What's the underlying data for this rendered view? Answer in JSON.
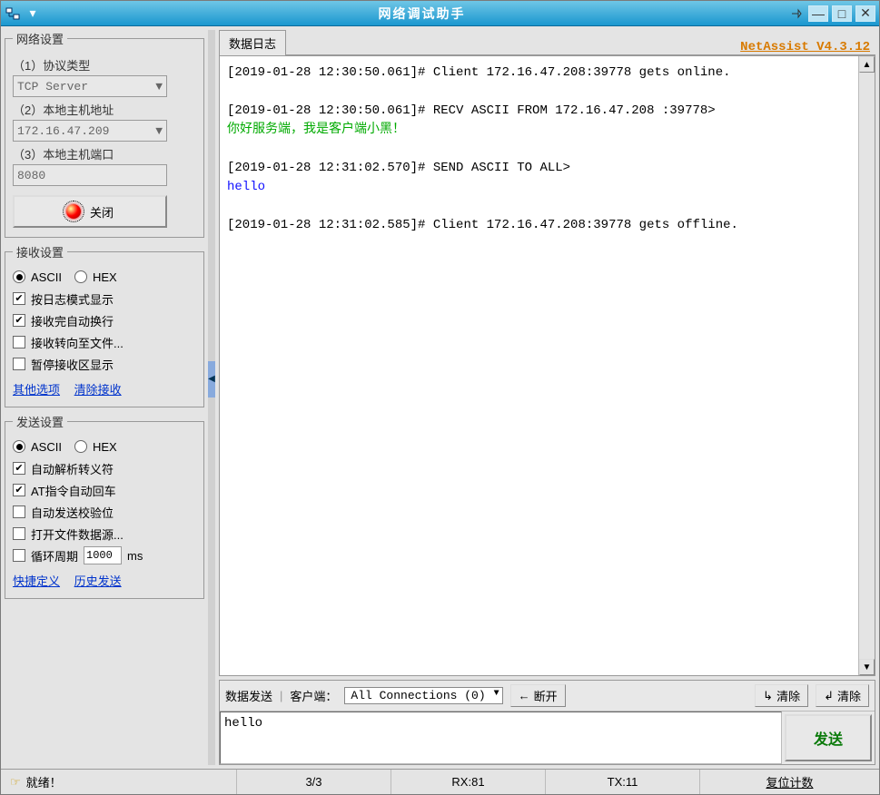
{
  "titlebar": {
    "title": "网络调试助手"
  },
  "version": "NetAssist V4.3.12",
  "network": {
    "legend": "网络设置",
    "protocol_label": "（1）协议类型",
    "protocol_value": "TCP Server",
    "host_label": "（2）本地主机地址",
    "host_value": "172.16.47.209",
    "port_label": "（3）本地主机端口",
    "port_value": "8080",
    "close_button": "关闭"
  },
  "recv": {
    "legend": "接收设置",
    "ascii": "ASCII",
    "hex": "HEX",
    "log_mode": "按日志模式显示",
    "auto_newline": "接收完自动换行",
    "to_file": "接收转向至文件...",
    "pause": "暂停接收区显示",
    "other_opts": "其他选项",
    "clear_recv": "清除接收"
  },
  "send": {
    "legend": "发送设置",
    "ascii": "ASCII",
    "hex": "HEX",
    "escape": "自动解析转义符",
    "at_cr": "AT指令自动回车",
    "auto_check": "自动发送校验位",
    "open_file": "打开文件数据源...",
    "loop_label_pre": "循环周期",
    "loop_value": "1000",
    "loop_unit": "ms",
    "quick_def": "快捷定义",
    "history": "历史发送"
  },
  "log_tab": "数据日志",
  "log_lines": [
    {
      "cls": "",
      "text": "[2019-01-28 12:30:50.061]# Client 172.16.47.208:39778 gets online."
    },
    {
      "cls": "",
      "text": ""
    },
    {
      "cls": "",
      "text": "[2019-01-28 12:30:50.061]# RECV ASCII FROM 172.16.47.208 :39778>"
    },
    {
      "cls": "green",
      "text": "你好服务端，我是客户端小黑！"
    },
    {
      "cls": "",
      "text": ""
    },
    {
      "cls": "",
      "text": "[2019-01-28 12:31:02.570]# SEND ASCII TO ALL>"
    },
    {
      "cls": "blue",
      "text": "hello"
    },
    {
      "cls": "",
      "text": ""
    },
    {
      "cls": "",
      "text": "[2019-01-28 12:31:02.585]# Client 172.16.47.208:39778 gets offline."
    }
  ],
  "send_panel": {
    "tab": "数据发送",
    "client_label": "客户端：",
    "conn_value": "All Connections (0)",
    "disconnect": "断开",
    "clear_l": "清除",
    "clear_r": "清除",
    "input_value": "hello",
    "send_btn": "发送"
  },
  "status": {
    "ready": "就绪！",
    "count": "3/3",
    "rx": "RX:81",
    "tx": "TX:11",
    "reset": "复位计数"
  }
}
